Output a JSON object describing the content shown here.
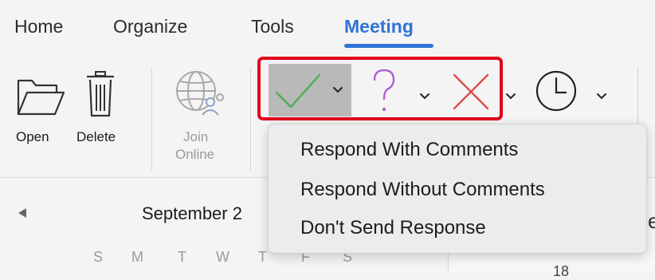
{
  "tabs": [
    {
      "label": "Home"
    },
    {
      "label": "Organize"
    },
    {
      "label": "Tools"
    },
    {
      "label": "Meeting",
      "active": true
    }
  ],
  "ribbon": {
    "open_label": "Open",
    "delete_label": "Delete",
    "join_online_line1": "Join",
    "join_online_line2": "Online"
  },
  "response_menu": {
    "items": [
      {
        "label": "Respond With Comments"
      },
      {
        "label": "Respond Without Comments"
      },
      {
        "label": "Don't Send Response"
      }
    ]
  },
  "calendar": {
    "month_label": "September 2",
    "weekdays": [
      "S",
      "M",
      "T",
      "W",
      "T",
      "F",
      "S"
    ],
    "right_partial_letter": "e",
    "right_partial_number": "18"
  },
  "colors": {
    "accent": "#2f73d8",
    "highlight_border": "#e3001b",
    "accept": "#4caf50",
    "tentative": "#b05fd6",
    "decline": "#e04a4a"
  },
  "icons": [
    "open-folder-icon",
    "trash-icon",
    "join-online-globe-icon",
    "accept-check-icon",
    "tentative-question-icon",
    "decline-x-icon",
    "propose-time-clock-icon",
    "chevron-down-icon",
    "previous-month-arrow-icon"
  ]
}
